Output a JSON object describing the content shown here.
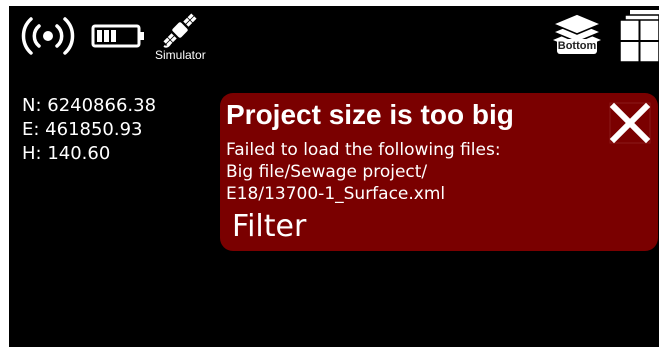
{
  "status_bar": {
    "signal_icon": "radio-signal-icon",
    "battery_icon": "battery-icon",
    "battery_level": 0.5,
    "satellite_icon": "satellite-icon",
    "gnss_source_label": "Simulator",
    "layers_icon": "layers-icon",
    "layers_label": "Bottom",
    "windows_icon": "window-layout-icon"
  },
  "position": {
    "north": "N: 6240866.38",
    "east": "E: 461850.93",
    "height": "H: 140.60"
  },
  "alert": {
    "title": "Project size is too big",
    "message_lines": [
      "Failed to load the following files:",
      "Big file/Sewage project/",
      "E18/13700-1_Surface.xml"
    ],
    "action_label": "Filter",
    "close_icon": "close-icon",
    "background_color": "#7a0000"
  }
}
